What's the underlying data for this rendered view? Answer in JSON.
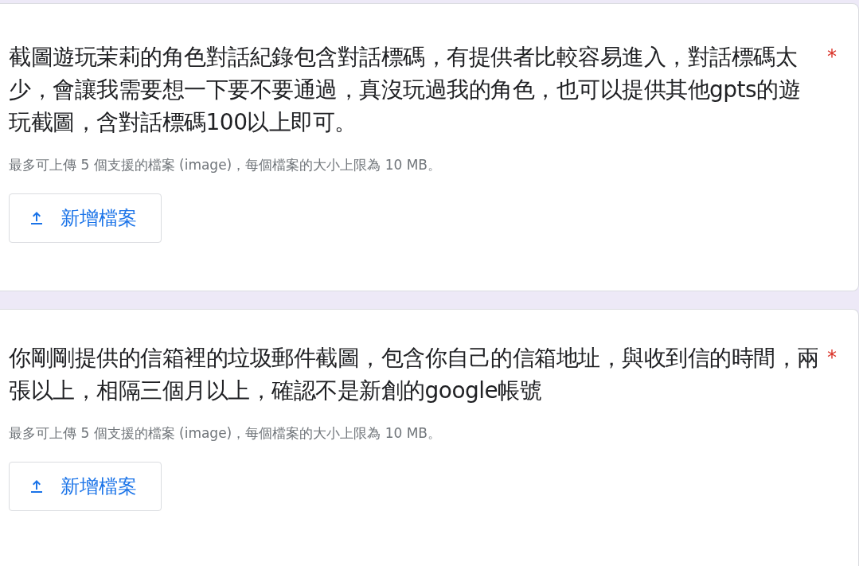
{
  "questions": [
    {
      "title": "截圖遊玩茉莉的角色對話紀錄包含對話標碼，有提供者比較容易進入，對話標碼太少，會讓我需要想一下要不要通過，真沒玩過我的角色，也可以提供其他gpts的遊玩截圖，含對話標碼100以上即可。",
      "required": true,
      "asterisk": "*",
      "helper": "最多可上傳 5 個支援的檔案 (image)，每個檔案的大小上限為 10 MB。",
      "button": "新增檔案"
    },
    {
      "title": "你剛剛提供的信箱裡的垃圾郵件截圖，包含你自己的信箱地址，與收到信的時間，兩張以上，相隔三個月以上，確認不是新創的google帳號",
      "required": true,
      "asterisk": "*",
      "helper": "最多可上傳 5 個支援的檔案 (image)，每個檔案的大小上限為 10 MB。",
      "button": "新增檔案"
    }
  ]
}
